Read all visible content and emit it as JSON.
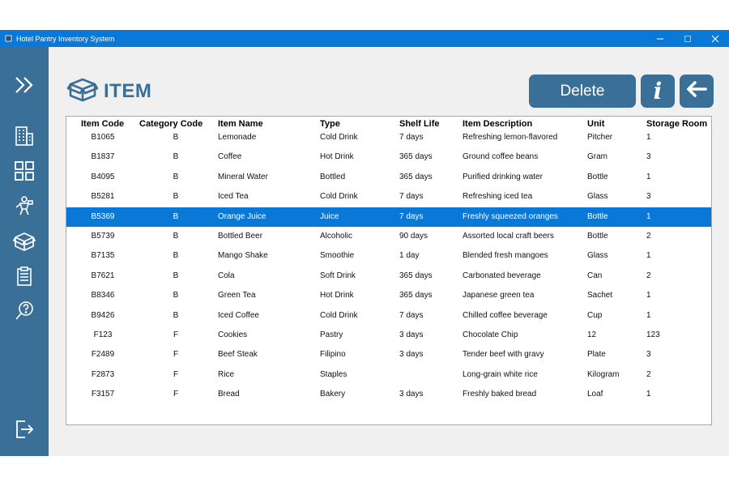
{
  "window": {
    "title": "Hotel Pantry Inventory System"
  },
  "header": {
    "title": "ITEM"
  },
  "buttons": {
    "delete": "Delete",
    "info": "i"
  },
  "icons": {
    "app": "app-icon",
    "minimize": "minimize-icon",
    "maximize": "maximize-icon",
    "close": "close-icon",
    "sidebar": [
      "expand-icon",
      "hotel-building-icon",
      "dashboard-grid-icon",
      "staff-icon",
      "box-icon",
      "clipboard-icon",
      "help-icon",
      "logout-icon"
    ],
    "back": "back-arrow-icon",
    "header": "box-icon"
  },
  "colors": {
    "accent": "#3a6f97",
    "titlebar": "#0a78d7",
    "selected_row": "#0a78d7"
  },
  "table": {
    "columns": [
      "Item Code",
      "Category Code",
      "Item Name",
      "Type",
      "Shelf Life",
      "Item Description",
      "Unit",
      "Storage Room"
    ],
    "rows": [
      [
        "B1065",
        "B",
        "Lemonade",
        "Cold Drink",
        "7 days",
        "Refreshing lemon-flavored",
        "Pitcher",
        "1"
      ],
      [
        "B1837",
        "B",
        "Coffee",
        "Hot Drink",
        "365 days",
        "Ground coffee beans",
        "Gram",
        "3"
      ],
      [
        "B4095",
        "B",
        "Mineral Water",
        "Bottled",
        "365 days",
        "Purified drinking water",
        "Bottle",
        "1"
      ],
      [
        "B5281",
        "B",
        "Iced Tea",
        "Cold Drink",
        "7 days",
        "Refreshing iced tea",
        "Glass",
        "3"
      ],
      [
        "B5369",
        "B",
        "Orange Juice",
        "Juice",
        "7 days",
        "Freshly squeezed oranges",
        "Bottle",
        "1"
      ],
      [
        "B5739",
        "B",
        "Bottled Beer",
        "Alcoholic",
        "90 days",
        "Assorted local craft beers",
        "Bottle",
        "2"
      ],
      [
        "B7135",
        "B",
        "Mango Shake",
        "Smoothie",
        "1 day",
        "Blended fresh mangoes",
        "Glass",
        "1"
      ],
      [
        "B7621",
        "B",
        "Cola",
        "Soft Drink",
        "365 days",
        "Carbonated beverage",
        "Can",
        "2"
      ],
      [
        "B8346",
        "B",
        "Green Tea",
        "Hot Drink",
        "365 days",
        "Japanese green tea",
        "Sachet",
        "1"
      ],
      [
        "B9426",
        "B",
        "Iced Coffee",
        "Cold Drink",
        "7 days",
        "Chilled coffee beverage",
        "Cup",
        "1"
      ],
      [
        "F123",
        "F",
        "Cookies",
        "Pastry",
        "3 days",
        "Chocolate Chip",
        "12",
        "123"
      ],
      [
        "F2489",
        "F",
        "Beef Steak",
        "Filipino",
        "3 days",
        "Tender beef with gravy",
        "Plate",
        "3"
      ],
      [
        "F2873",
        "F",
        "Rice",
        "Staples",
        "",
        "Long-grain white rice",
        "Kilogram",
        "2"
      ],
      [
        "F3157",
        "F",
        "Bread",
        "Bakery",
        "3 days",
        "Freshly baked bread",
        "Loaf",
        "1"
      ]
    ],
    "selected_index": 4
  }
}
